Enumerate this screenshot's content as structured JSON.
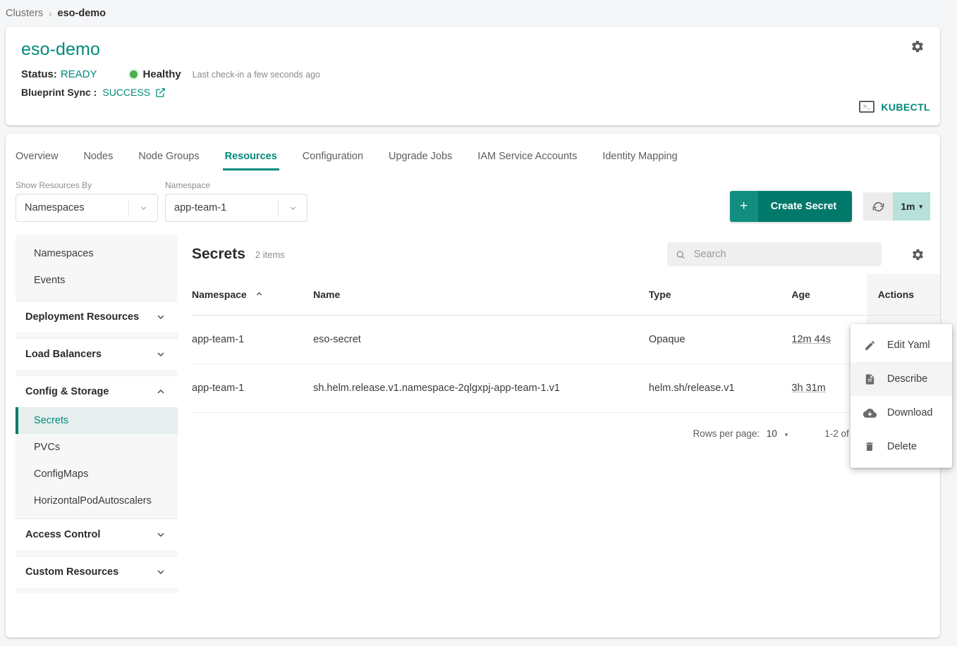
{
  "breadcrumb": {
    "root": "Clusters",
    "separator": "›",
    "current": "eso-demo"
  },
  "cluster_header": {
    "title": "eso-demo",
    "status_label": "Status:",
    "status_value": "READY",
    "health_text": "Healthy",
    "health_dot_color": "#4CAF50",
    "last_checkin": "Last check-in a few seconds ago",
    "blueprint_label": "Blueprint Sync :",
    "blueprint_value": "SUCCESS",
    "kubectl_label": "KUBECTL",
    "kubectl_icon_glyph": ">_",
    "gear_icon": "gear-icon",
    "accent_color": "#00897B"
  },
  "tabs": [
    {
      "label": "Overview",
      "active": false
    },
    {
      "label": "Nodes",
      "active": false
    },
    {
      "label": "Node Groups",
      "active": false
    },
    {
      "label": "Resources",
      "active": true
    },
    {
      "label": "Configuration",
      "active": false
    },
    {
      "label": "Upgrade Jobs",
      "active": false
    },
    {
      "label": "IAM Service Accounts",
      "active": false
    },
    {
      "label": "Identity Mapping",
      "active": false
    }
  ],
  "filters": {
    "show_by": {
      "label": "Show Resources By",
      "value": "Namespaces"
    },
    "namespace": {
      "label": "Namespace",
      "value": "app-team-1"
    }
  },
  "toolbar": {
    "create_plus": "+",
    "create_label": "Create Secret",
    "refresh_icon": "refresh-icon",
    "interval_value": "1m",
    "interval_caret": "▾",
    "create_bg": "#00796B",
    "interval_bg": "#b7e1da"
  },
  "sidebar": {
    "top_items": [
      {
        "label": "Namespaces"
      },
      {
        "label": "Events"
      }
    ],
    "groups": [
      {
        "label": "Deployment Resources",
        "expanded": false,
        "caret": "⌄",
        "items": []
      },
      {
        "label": "Load Balancers",
        "expanded": false,
        "caret": "⌄",
        "items": []
      },
      {
        "label": "Config & Storage",
        "expanded": true,
        "caret": "⌃",
        "items": [
          {
            "label": "Secrets",
            "active": true
          },
          {
            "label": "PVCs",
            "active": false
          },
          {
            "label": "ConfigMaps",
            "active": false
          },
          {
            "label": "HorizontalPodAutoscalers",
            "active": false
          }
        ]
      },
      {
        "label": "Access Control",
        "expanded": false,
        "caret": "⌄",
        "items": []
      },
      {
        "label": "Custom Resources",
        "expanded": false,
        "caret": "⌄",
        "items": []
      }
    ]
  },
  "table": {
    "title": "Secrets",
    "count_text": "2 items",
    "search_placeholder": "Search",
    "search_value": "",
    "settings_icon": "gear-icon",
    "columns": [
      {
        "label": "Namespace",
        "sorted": true,
        "sort_caret": "⌃"
      },
      {
        "label": "Name",
        "sorted": false
      },
      {
        "label": "Type",
        "sorted": false
      },
      {
        "label": "Age",
        "sorted": false
      },
      {
        "label": "Actions",
        "sorted": false
      }
    ],
    "rows": [
      {
        "namespace": "app-team-1",
        "name": "eso-secret",
        "type": "Opaque",
        "age": "12m 44s"
      },
      {
        "namespace": "app-team-1",
        "name": "sh.helm.release.v1.namespace-2qlgxpj-app-team-1.v1",
        "type": "helm.sh/release.v1",
        "age": "3h 31m"
      }
    ],
    "pagination": {
      "rows_per_page_label": "Rows per page:",
      "rows_per_page_value": "10",
      "caret": "▾",
      "range_text": "1-2 of 2"
    }
  },
  "context_menu": {
    "items": [
      {
        "label": "Edit Yaml",
        "icon": "pencil-icon",
        "hover": false
      },
      {
        "label": "Describe",
        "icon": "document-icon",
        "hover": true
      },
      {
        "label": "Download",
        "icon": "cloud-download-icon",
        "hover": false
      },
      {
        "label": "Delete",
        "icon": "trash-icon",
        "hover": false
      }
    ]
  }
}
